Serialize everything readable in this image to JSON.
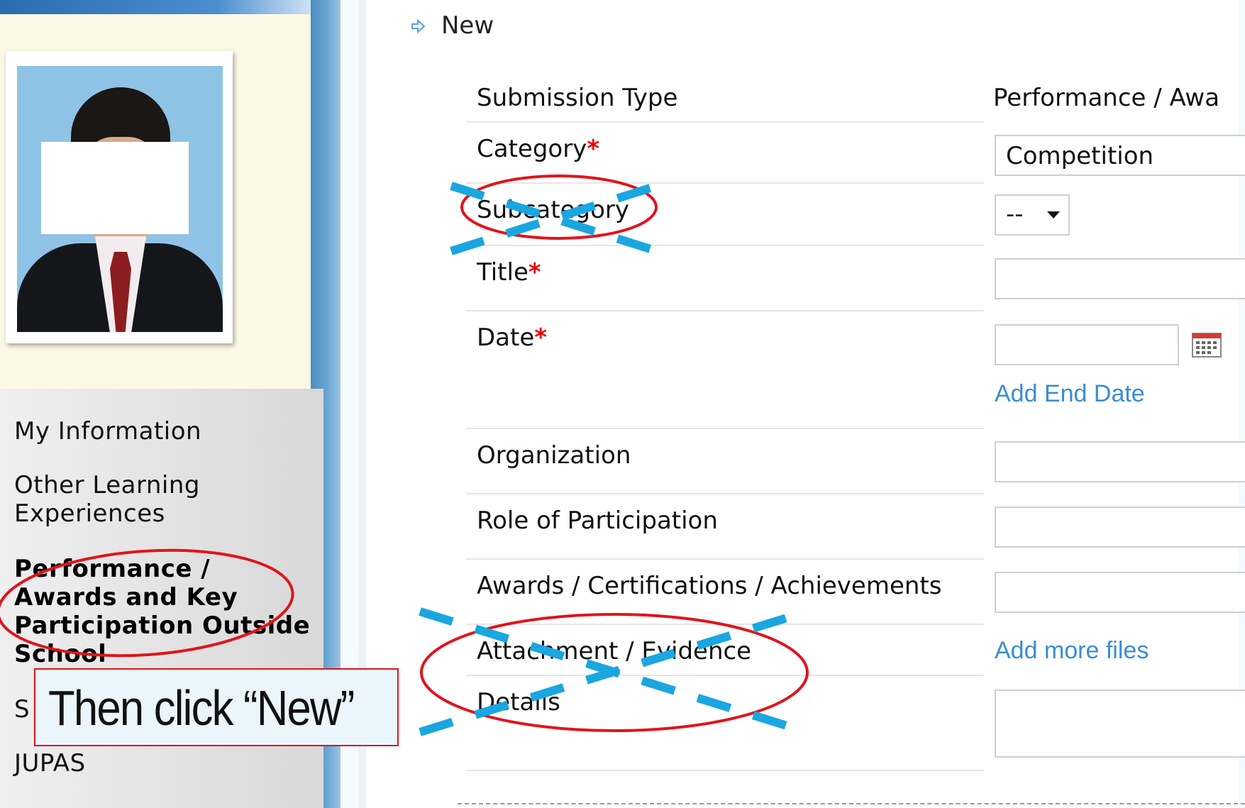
{
  "sidebar": {
    "items": [
      {
        "label": "My Information"
      },
      {
        "label_line1": "Other Learning",
        "label_line2": "Experiences"
      },
      {
        "label_line1": "Performance /",
        "label_line2": "Awards and Key",
        "label_line3": "Participation Outside",
        "label_line4": "School"
      },
      {
        "label": "S"
      },
      {
        "label": "JUPAS"
      }
    ]
  },
  "main": {
    "new_label": "New",
    "form": {
      "submission_type": {
        "label": "Submission Type",
        "value": "Performance / Awa"
      },
      "category": {
        "label": "Category",
        "required_mark": "*",
        "value": "Competition"
      },
      "subcategory": {
        "label": "Subcategory",
        "value": "--"
      },
      "title": {
        "label": "Title",
        "required_mark": "*",
        "value": ""
      },
      "date": {
        "label": "Date",
        "required_mark": "*",
        "value": "",
        "add_end_date": "Add End Date"
      },
      "organization": {
        "label": "Organization",
        "value": ""
      },
      "role": {
        "label": "Role of Participation",
        "value": ""
      },
      "awards": {
        "label": "Awards / Certifications / Achievements",
        "value": ""
      },
      "attachment": {
        "label": "Attachment / Evidence",
        "add_more": "Add more files"
      },
      "details": {
        "label": "Details",
        "value": ""
      }
    }
  },
  "annotation": {
    "callout_text": "Then click “New”",
    "highlight_color": "#e0141c",
    "cross_color": "#1aa6e0"
  },
  "colors": {
    "link": "#3a8ed0",
    "required": "#e00000",
    "sidebar_top": "#fbf8e6"
  }
}
